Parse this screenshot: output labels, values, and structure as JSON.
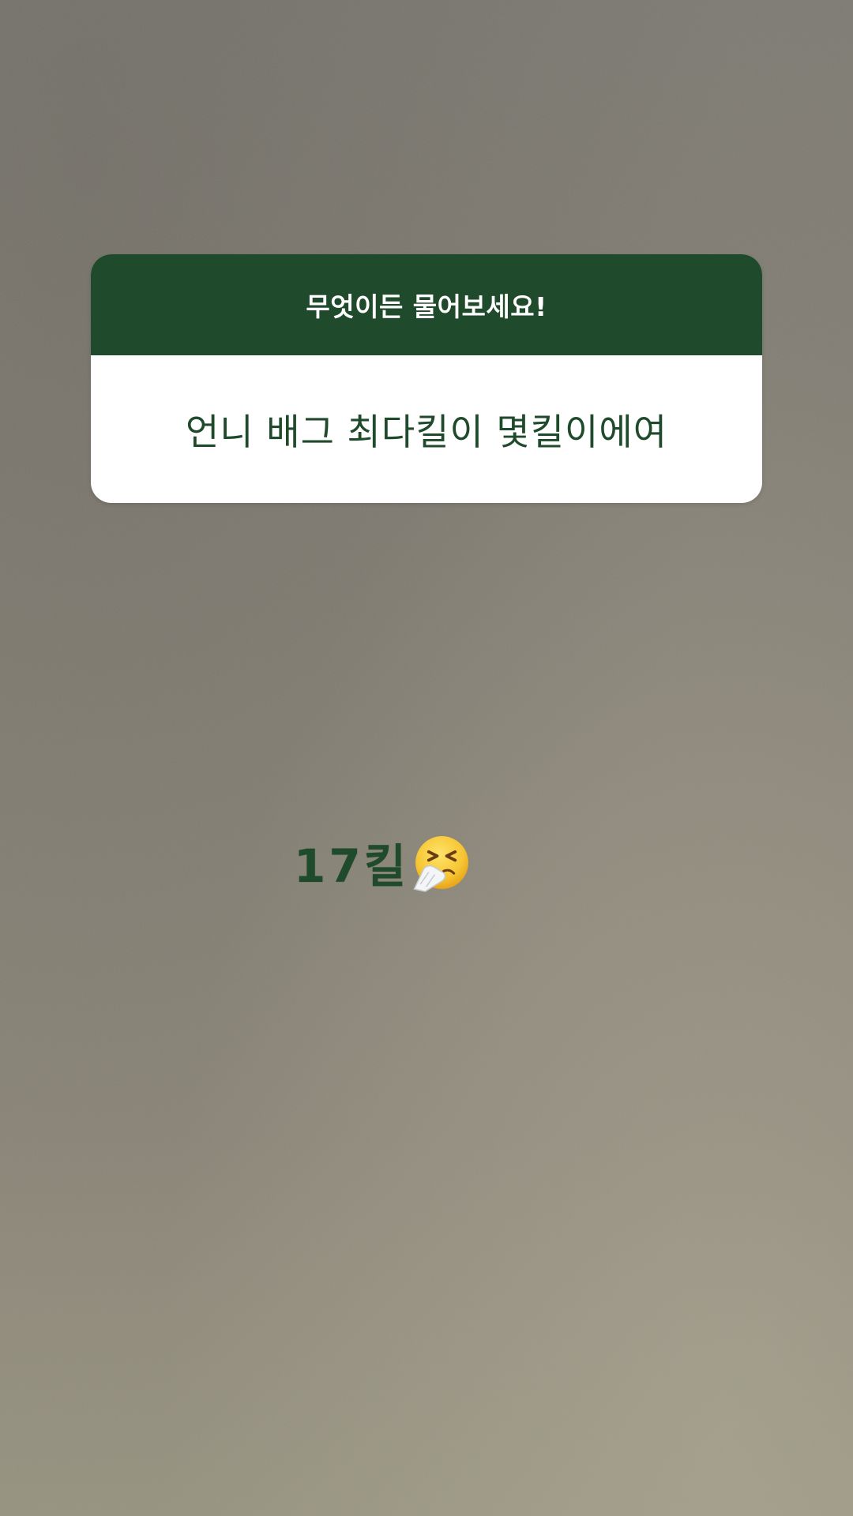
{
  "question_sticker": {
    "prompt": "무엇이든 물어보세요!",
    "question": "언니 배그 최다킬이 몇킬이에여"
  },
  "answer": {
    "text": "17킬",
    "emoji_icon": "sneezing-face-icon"
  },
  "colors": {
    "sticker_header": "#1f4a2b",
    "sticker_body": "#ffffff",
    "answer_text": "#1f4a2b",
    "emoji_face": "#f6c532",
    "background": "#847f74"
  }
}
